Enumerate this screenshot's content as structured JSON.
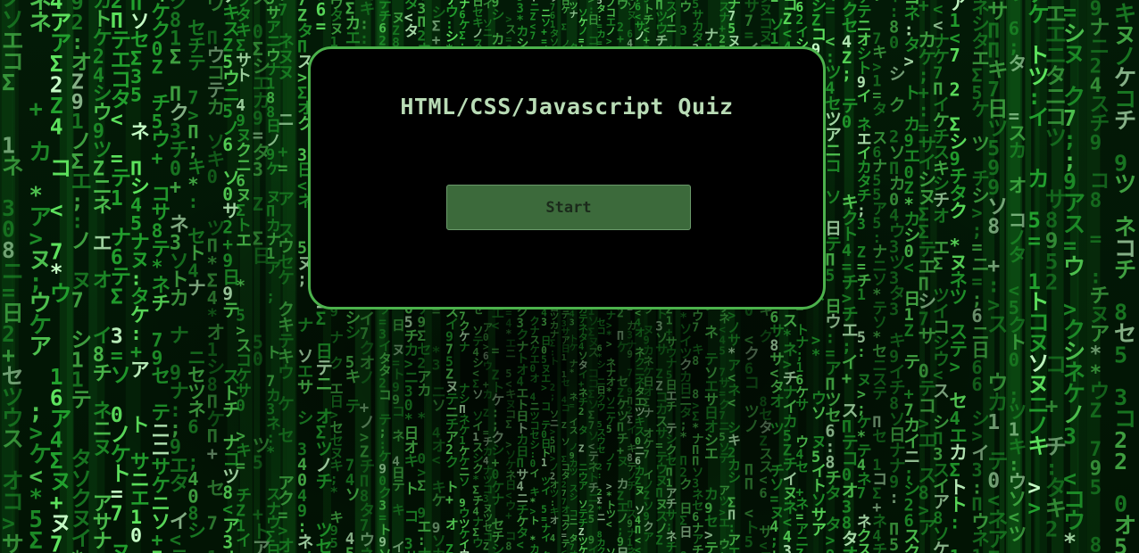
{
  "quiz": {
    "title": "HTML/CSS/Javascript Quiz",
    "start_label": "Start"
  },
  "theme": {
    "border": "#4cb24c",
    "card_background": "#000000",
    "title_color": "#b9dcb6",
    "button_background": "#3c6a3b",
    "button_text": "#1b2a1b",
    "rain_bright": "#7dff7d",
    "rain_dim": "#1f8f2a"
  },
  "background": {
    "description_icon": "matrix-digital-rain-background"
  }
}
